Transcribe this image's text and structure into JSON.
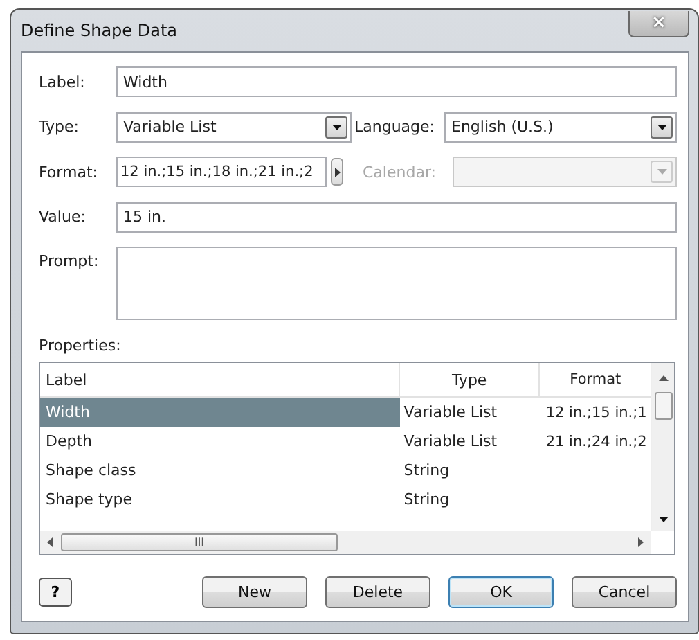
{
  "window": {
    "title": "Define Shape Data",
    "close": "×"
  },
  "form": {
    "label": {
      "caption": "Label:",
      "value": "Width"
    },
    "type": {
      "caption": "Type:",
      "value": "Variable List"
    },
    "language": {
      "caption": "Language:",
      "value": "English (U.S.)"
    },
    "format": {
      "caption": "Format:",
      "value": "12 in.;15 in.;18 in.;21 in.;2"
    },
    "calendar": {
      "caption": "Calendar:",
      "disabled": true
    },
    "value": {
      "caption": "Value:",
      "value": "15 in."
    },
    "prompt": {
      "caption": "Prompt:"
    }
  },
  "properties": {
    "caption": "Properties:",
    "columns": [
      "Label",
      "Type",
      "Format"
    ],
    "rows": [
      {
        "cells": [
          "Width",
          "Variable List",
          "12 in.;15 in.;1"
        ],
        "selected": true
      },
      {
        "cells": [
          "Depth",
          "Variable List",
          "21 in.;24 in.;2"
        ],
        "selected": false
      },
      {
        "cells": [
          "Shape class",
          "String",
          ""
        ],
        "selected": false
      },
      {
        "cells": [
          "Shape type",
          "String",
          ""
        ],
        "selected": false
      }
    ],
    "scroll_grip": "III"
  },
  "help": "?",
  "buttons": [
    {
      "label": "New",
      "default": false
    },
    {
      "label": "Delete",
      "default": false
    },
    {
      "label": "OK",
      "default": true
    },
    {
      "label": "Cancel",
      "default": false
    }
  ]
}
